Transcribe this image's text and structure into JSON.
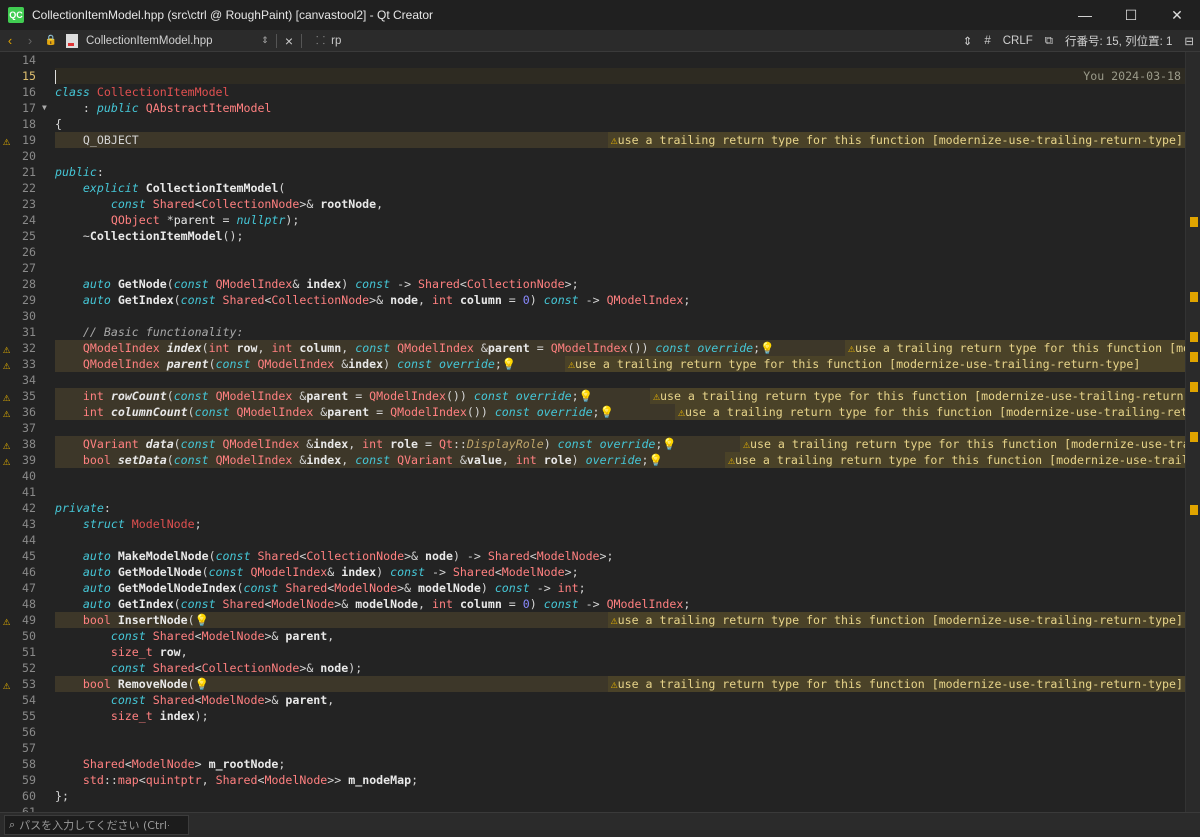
{
  "window": {
    "title": "CollectionItemModel.hpp (src\\ctrl @ RoughPaint) [canvastool2] - Qt Creator",
    "app_icon_text": "QC",
    "minimize": "—",
    "maximize": "☐",
    "close": "✕"
  },
  "toolbar": {
    "back": "‹",
    "forward": "›",
    "lock": "🔒",
    "filename": "CollectionItemModel.hpp",
    "updown": "⇕",
    "close": "×",
    "symbols_icon": "⸬",
    "current_symbol": "rp",
    "hash": "#",
    "line_ending": "CRLF",
    "position": "行番号: 15, 列位置: 1",
    "split": "⊟"
  },
  "editor": {
    "blame": "You 2024-03-18",
    "warning_text": "use a trailing return type for this function [modernize-use-trailing-return-type]",
    "lines": [
      {
        "n": "14"
      },
      {
        "n": "15"
      },
      {
        "n": "16"
      },
      {
        "n": "17"
      },
      {
        "n": "18"
      },
      {
        "n": "19"
      },
      {
        "n": "20"
      },
      {
        "n": "21"
      },
      {
        "n": "22"
      },
      {
        "n": "23"
      },
      {
        "n": "24"
      },
      {
        "n": "25"
      },
      {
        "n": "26"
      },
      {
        "n": "27"
      },
      {
        "n": "28"
      },
      {
        "n": "29"
      },
      {
        "n": "30"
      },
      {
        "n": "31"
      },
      {
        "n": "32"
      },
      {
        "n": "33"
      },
      {
        "n": "34"
      },
      {
        "n": "35"
      },
      {
        "n": "36"
      },
      {
        "n": "37"
      },
      {
        "n": "38"
      },
      {
        "n": "39"
      },
      {
        "n": "40"
      },
      {
        "n": "41"
      },
      {
        "n": "42"
      },
      {
        "n": "43"
      },
      {
        "n": "44"
      },
      {
        "n": "45"
      },
      {
        "n": "46"
      },
      {
        "n": "47"
      },
      {
        "n": "48"
      },
      {
        "n": "49"
      },
      {
        "n": "50"
      },
      {
        "n": "51"
      },
      {
        "n": "52"
      },
      {
        "n": "53"
      },
      {
        "n": "54"
      },
      {
        "n": "55"
      },
      {
        "n": "56"
      },
      {
        "n": "57"
      },
      {
        "n": "58"
      },
      {
        "n": "59"
      },
      {
        "n": "60"
      },
      {
        "n": "61"
      }
    ],
    "warning_lines": [
      "19",
      "32",
      "33",
      "35",
      "36",
      "38",
      "39",
      "49",
      "53"
    ]
  },
  "statusbar": {
    "locator_placeholder": "パスを入力してください (Ctrl+..."
  }
}
